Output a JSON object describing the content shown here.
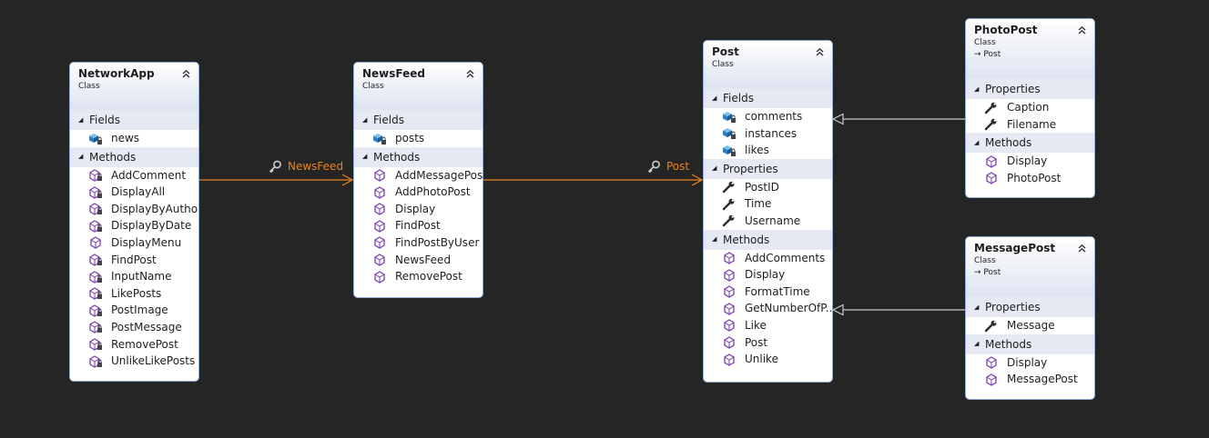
{
  "colors": {
    "background": "#252526",
    "box_border": "#8fb0d8",
    "association": "#e8831a",
    "inheritance": "#c8c8c8",
    "icon_purple": "#7a3fb0",
    "icon_blue": "#2f7fbf"
  },
  "classes": [
    {
      "name": "NetworkApp",
      "stereotype": "Class",
      "base": "",
      "sections": [
        {
          "title": "Fields",
          "members": [
            {
              "name": "news",
              "icon": "private-field-icon"
            }
          ]
        },
        {
          "title": "Methods",
          "members": [
            {
              "name": "AddComment",
              "icon": "private-method-icon"
            },
            {
              "name": "DisplayAll",
              "icon": "private-method-icon"
            },
            {
              "name": "DisplayByAuthor",
              "icon": "private-method-icon"
            },
            {
              "name": "DisplayByDate",
              "icon": "private-method-icon"
            },
            {
              "name": "DisplayMenu",
              "icon": "method-icon"
            },
            {
              "name": "FindPost",
              "icon": "private-method-icon"
            },
            {
              "name": "InputName",
              "icon": "private-method-icon"
            },
            {
              "name": "LikePosts",
              "icon": "private-method-icon"
            },
            {
              "name": "PostImage",
              "icon": "private-method-icon"
            },
            {
              "name": "PostMessage",
              "icon": "private-method-icon"
            },
            {
              "name": "RemovePost",
              "icon": "private-method-icon"
            },
            {
              "name": "UnlikeLikePosts",
              "icon": "private-method-icon"
            }
          ]
        }
      ]
    },
    {
      "name": "NewsFeed",
      "stereotype": "Class",
      "base": "",
      "sections": [
        {
          "title": "Fields",
          "members": [
            {
              "name": "posts",
              "icon": "private-field-icon"
            }
          ]
        },
        {
          "title": "Methods",
          "members": [
            {
              "name": "AddMessagePost",
              "icon": "method-icon"
            },
            {
              "name": "AddPhotoPost",
              "icon": "method-icon"
            },
            {
              "name": "Display",
              "icon": "method-icon"
            },
            {
              "name": "FindPost",
              "icon": "method-icon"
            },
            {
              "name": "FindPostByUser",
              "icon": "method-icon"
            },
            {
              "name": "NewsFeed",
              "icon": "method-icon"
            },
            {
              "name": "RemovePost",
              "icon": "method-icon"
            }
          ]
        }
      ]
    },
    {
      "name": "Post",
      "stereotype": "Class",
      "base": "",
      "sections": [
        {
          "title": "Fields",
          "members": [
            {
              "name": "comments",
              "icon": "private-field-icon"
            },
            {
              "name": "instances",
              "icon": "private-field-icon"
            },
            {
              "name": "likes",
              "icon": "private-field-icon"
            }
          ]
        },
        {
          "title": "Properties",
          "members": [
            {
              "name": "PostID",
              "icon": "property-icon"
            },
            {
              "name": "Time",
              "icon": "property-icon"
            },
            {
              "name": "Username",
              "icon": "property-icon"
            }
          ]
        },
        {
          "title": "Methods",
          "members": [
            {
              "name": "AddComments",
              "icon": "method-icon"
            },
            {
              "name": "Display",
              "icon": "method-icon"
            },
            {
              "name": "FormatTime",
              "icon": "method-icon"
            },
            {
              "name": "GetNumberOfP...",
              "icon": "method-icon"
            },
            {
              "name": "Like",
              "icon": "method-icon"
            },
            {
              "name": "Post",
              "icon": "method-icon"
            },
            {
              "name": "Unlike",
              "icon": "method-icon"
            }
          ]
        }
      ]
    },
    {
      "name": "PhotoPost",
      "stereotype": "Class",
      "base": "Post",
      "sections": [
        {
          "title": "Properties",
          "members": [
            {
              "name": "Caption",
              "icon": "property-icon"
            },
            {
              "name": "Filename",
              "icon": "property-icon"
            }
          ]
        },
        {
          "title": "Methods",
          "members": [
            {
              "name": "Display",
              "icon": "method-icon"
            },
            {
              "name": "PhotoPost",
              "icon": "method-icon"
            }
          ]
        }
      ]
    },
    {
      "name": "MessagePost",
      "stereotype": "Class",
      "base": "Post",
      "sections": [
        {
          "title": "Properties",
          "members": [
            {
              "name": "Message",
              "icon": "property-icon"
            }
          ]
        },
        {
          "title": "Methods",
          "members": [
            {
              "name": "Display",
              "icon": "method-icon"
            },
            {
              "name": "MessagePost",
              "icon": "method-icon"
            }
          ]
        }
      ]
    }
  ],
  "associations": [
    {
      "label": "NewsFeed",
      "icon": "key-icon"
    },
    {
      "label": "Post",
      "icon": "key-icon"
    }
  ]
}
